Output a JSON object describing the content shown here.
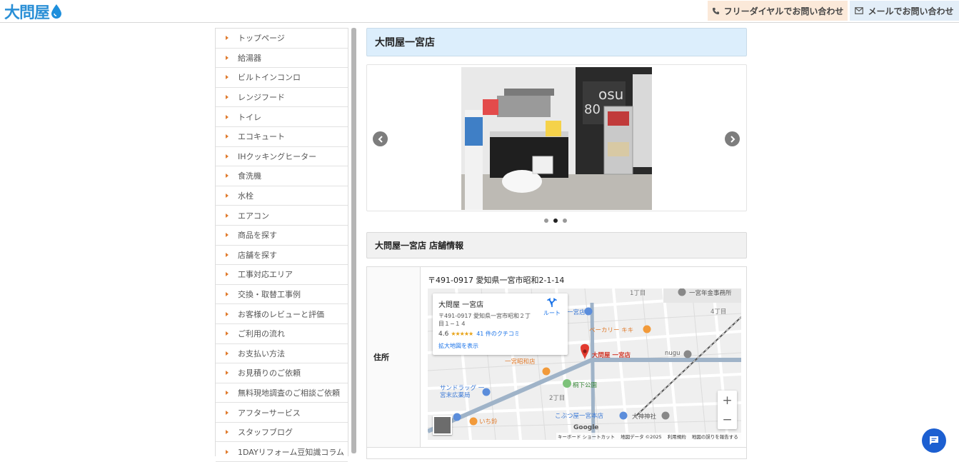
{
  "header": {
    "logo_text": "大問屋",
    "tel_button": "フリーダイヤルでお問い合わせ",
    "mail_button": "メールでお問い合わせ",
    "colors": {
      "tel_bg": "#fbe9d9",
      "mail_bg": "#e3eef8",
      "brand": "#2a8fd6"
    }
  },
  "sidebar": {
    "items": [
      "トップページ",
      "給湯器",
      "ビルトインコンロ",
      "レンジフード",
      "トイレ",
      "エコキュート",
      "IHクッキングヒーター",
      "食洗機",
      "水栓",
      "エアコン",
      "商品を探す",
      "店舗を探す",
      "工事対応エリア",
      "交換・取替工事例",
      "お客様のレビューと評価",
      "ご利用の流れ",
      "お支払い方法",
      "お見積りのご依頼",
      "無料現地調査のご相談ご依頼",
      "アフターサービス",
      "スタッフブログ",
      "1DAYリフォーム豆知識コラム"
    ]
  },
  "main": {
    "page_title": "大問屋一宮店",
    "slider": {
      "prev_icon": "chevron-left-icon",
      "next_icon": "chevron-right-icon",
      "active_dot": 2,
      "dot_count": 3
    },
    "section_title": "大問屋一宮店 店舗情報",
    "table": {
      "address_label": "住所",
      "address_value": "〒491-0917 愛知県一宮市昭和2-1-14"
    },
    "map": {
      "card": {
        "name": "大問屋 一宮店",
        "address": "〒491-0917 愛知県一宮市昭和２丁目１−１４",
        "route": "ルート",
        "rating": "4.6",
        "stars": "★★★★★",
        "reviews": "41 件のクチコミ",
        "larger_map": "拡大地図を表示"
      },
      "labels": {
        "pin_label": "大問屋 一宮店",
        "bakery": "ベーカリー キキ",
        "nugu": "nugu",
        "ichinomiya": "一宮店",
        "gas": "一宮年金事務所",
        "chome1": "1丁目",
        "chome4": "4丁目",
        "chome2": "2丁目",
        "park": "桐下公園",
        "drug": "サンドラッグ 一宮末広薬局",
        "ichiban": "いち鈴",
        "kobutsu": "こぶつ屋一宮本店",
        "shrine": "大神神社",
        "shopname": "一宮昭和店"
      },
      "google": "Google",
      "footer": [
        "キーボード ショートカット",
        "地図データ ©2025",
        "利用規約",
        "地図の誤りを報告する"
      ],
      "zoom_in": "+",
      "zoom_out": "−"
    }
  }
}
